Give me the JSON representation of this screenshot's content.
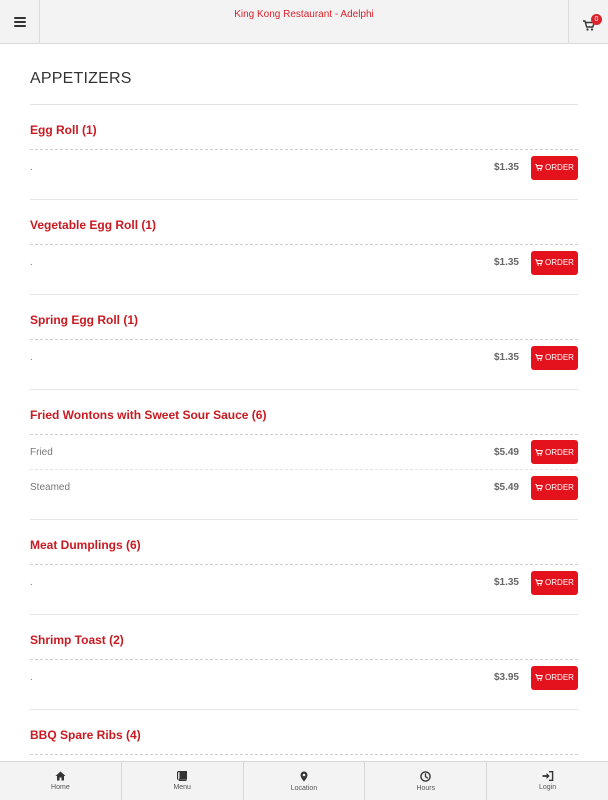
{
  "header": {
    "title": "King Kong Restaurant - Adelphi",
    "cart_count": "0"
  },
  "section": {
    "title": "APPETIZERS"
  },
  "items": [
    {
      "name": "Egg Roll (1)",
      "options": [
        {
          "label": ".",
          "price": "$1.35",
          "button": "ORDER"
        }
      ]
    },
    {
      "name": "Vegetable Egg Roll (1)",
      "options": [
        {
          "label": ".",
          "price": "$1.35",
          "button": "ORDER"
        }
      ]
    },
    {
      "name": "Spring Egg Roll (1)",
      "options": [
        {
          "label": ".",
          "price": "$1.35",
          "button": "ORDER"
        }
      ]
    },
    {
      "name": "Fried Wontons with Sweet Sour Sauce (6)",
      "options": [
        {
          "label": "Fried",
          "price": "$5.49",
          "button": "ORDER"
        },
        {
          "label": "Steamed",
          "price": "$5.49",
          "button": "ORDER"
        }
      ]
    },
    {
      "name": "Meat Dumplings (6)",
      "options": [
        {
          "label": ".",
          "price": "$1.35",
          "button": "ORDER"
        }
      ]
    },
    {
      "name": "Shrimp Toast (2)",
      "options": [
        {
          "label": ".",
          "price": "$3.95",
          "button": "ORDER"
        }
      ]
    },
    {
      "name": "BBQ Spare Ribs (4)",
      "options": []
    }
  ],
  "bottom_nav": [
    {
      "label": "Home",
      "icon": "home-icon"
    },
    {
      "label": "Menu",
      "icon": "book-icon"
    },
    {
      "label": "Location",
      "icon": "map-marker-icon"
    },
    {
      "label": "Hours",
      "icon": "clock-icon"
    },
    {
      "label": "Login",
      "icon": "sign-in-icon"
    }
  ],
  "colors": {
    "accent": "#d9232d",
    "button": "#e3121c",
    "bar": "#f3f3f3"
  }
}
